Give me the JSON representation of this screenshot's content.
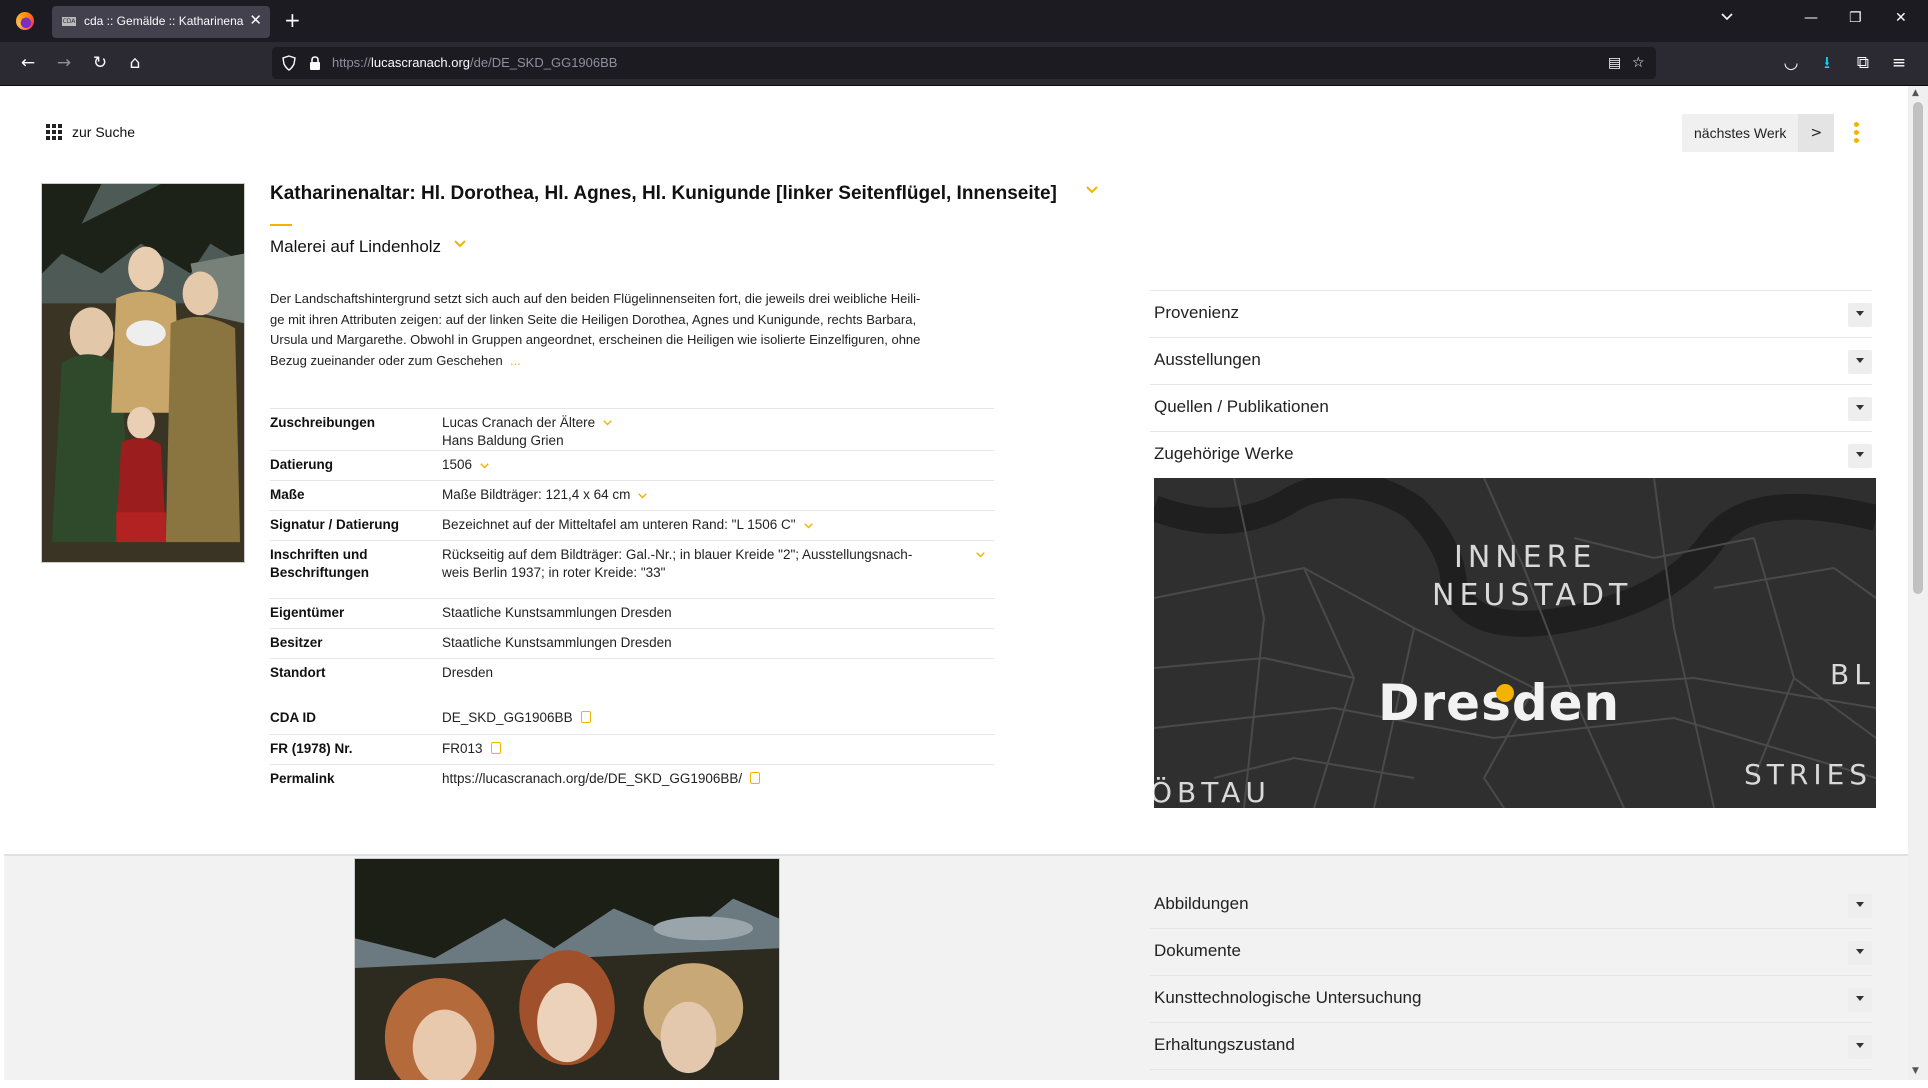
{
  "browser": {
    "tab_title": "cda :: Gemälde :: Katharinenaltar",
    "tab_favicon_text": "CDA",
    "url_prefix": "https://",
    "url_host": "lucascranach.org",
    "url_path": "/de/DE_SKD_GG1906BB"
  },
  "header": {
    "search_link": "zur Suche",
    "next_work": "nächstes Werk",
    "next_arrow": ">"
  },
  "artwork": {
    "title": "Katharinenaltar: Hl. Dorothea, Hl. Agnes, Hl. Kunigunde [linker Seitenflügel, Innenseite]",
    "medium": "Malerei auf Lindenholz",
    "description_lines": [
      "Der Landschaftshintergrund setzt sich auch auf den beiden Flügelinnenseiten fort, die jeweils drei weibliche Heili-",
      "ge mit ihren Attributen zeigen: auf der linken Seite die Heiligen Dorothea, Agnes und Kunigunde, rechts Barbara,",
      "Ursula und Margarethe. Obwohl in Gruppen angeordnet, erscheinen die Heiligen wie isolierte Einzelfiguren, ohne",
      "Bezug zueinander oder zum Geschehen"
    ],
    "description_more": "..."
  },
  "details": {
    "attribution_label": "Zuschreibungen",
    "attribution_1": "Lucas Cranach der Ältere",
    "attribution_2": "Hans Baldung Grien",
    "date_label": "Datierung",
    "date_value": "1506",
    "dims_label": "Maße",
    "dims_value": "Maße Bildträger: 121,4 x 64 cm",
    "signature_label": "Signatur / Datierung",
    "signature_value": "Bezeichnet auf der Mitteltafel am unteren Rand: \"L 1506 C\"",
    "inscriptions_label_1": "Inschriften und",
    "inscriptions_label_2": "Beschriftungen",
    "inscriptions_value_1": "Rückseitig auf dem Bildträger: Gal.-Nr.; in blauer Kreide \"2\"; Ausstellungsnach-",
    "inscriptions_value_2": "weis Berlin 1937; in roter Kreide: \"33\"",
    "owner_label": "Eigentümer",
    "owner_value": "Staatliche Kunstsammlungen Dresden",
    "holder_label": "Besitzer",
    "holder_value": "Staatliche Kunstsammlungen Dresden",
    "location_label": "Standort",
    "location_value": "Dresden",
    "cda_label": "CDA ID",
    "cda_value": "DE_SKD_GG1906BB",
    "fr_label": "FR (1978) Nr.",
    "fr_value": "FR013",
    "permalink_label": "Permalink",
    "permalink_value": "https://lucascranach.org/de/DE_SKD_GG1906BB/"
  },
  "accordion_top": [
    "Provenienz",
    "Ausstellungen",
    "Quellen / Publikationen",
    "Zugehörige Werke"
  ],
  "accordion_bottom": [
    "Abbildungen",
    "Dokumente",
    "Kunsttechnologische Untersuchung",
    "Erhaltungszustand"
  ],
  "map": {
    "district_1": "INNERE",
    "district_2": "NEUSTADT",
    "city": "Dresden",
    "edge_top": "BL",
    "edge_right": "STRIES",
    "edge_left": "ÖBTAU"
  },
  "colors": {
    "accent": "#f2b400",
    "chrome_dark": "#1c1b22",
    "chrome_nav": "#2b2a33",
    "map_bg": "#2f2f2f"
  }
}
